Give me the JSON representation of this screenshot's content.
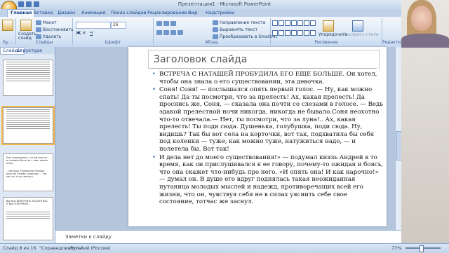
{
  "app": {
    "window_title": "Презентация1 - Microsoft PowerPoint"
  },
  "ribbon": {
    "tabs": [
      "Главная",
      "Вставка",
      "Дизайн",
      "Анимация",
      "Показ слайдов",
      "Рецензирование",
      "Вид",
      "Надстройки"
    ],
    "active_tab": "Главная",
    "groups": {
      "clipboard": "Бу…",
      "slides": "Слайды",
      "font": "Шрифт",
      "paragraph": "Абзац",
      "drawing": "Рисование",
      "editing": "Редакти…"
    },
    "buttons": {
      "create_slide": "Создать слайд",
      "layout": "Макет",
      "restore": "Восстановить",
      "delete": "Удалить",
      "text_direction": "Направление текста",
      "align_text": "Выровнять текст",
      "smartart": "Преобразовать в SmartArt",
      "arrange": "Упорядочить",
      "quick_styles": "Экспресс-стили"
    },
    "font_name": "",
    "font_size": "26"
  },
  "panel": {
    "tabs": [
      "Слайды",
      "Структура"
    ],
    "active_tab": "Слайды"
  },
  "slide": {
    "title": "Заголовок слайда",
    "paragraphs": [
      "ВСТРЕЧА С НАТАШЕЙ ПРОБУДИЛА ЕГО ЕЩЕ БОЛЬШЕ. Он хотел, чтобы она знала о его существовании, эта девочка.",
      "Соня! Соня! — послышался опять первый голос. — Ну, как можно спать! Да ты посмотри, что за прелесть! Ах, какая прелесть! Да проснись же, Соня, — сказала она почти со слезами в голосе. — Ведь эдакой прелестной ночи никогда, никогда не бывало.Соня неохотно что-то отвечала.— Нет, ты посмотри, что за луна!.. Ах, какая прелесть! Ты поди сюда. Душенька, голубушка, поди сюда. Ну, видишь? Так бы вот села на корточки, вот так, подхватила бы себя под коленки — туже, как можно туже, натужиться надо, — и полетела бы. Вот так!",
      "И дела нет до моего существования!» — подумал князь Андрей в то время, как он прислушивался к ее говору, почему-то ожидая и боясь, что она скажет что-нибудь про него. «И опять она! И как нарочно!» — думал он. В душе его вдруг поднялась такая неожиданная путаница молодых мыслей и надежд, противоречащих всей его жизни, что он, чувствуя себя не в силах уяснить себе свое состояние, тотчас же заснул."
    ]
  },
  "notes": {
    "placeholder": "Заметки к слайду"
  },
  "status": {
    "slide_counter": "Слайд 8 из 16",
    "theme": "\"Справедливость\"",
    "language": "Русский (Россия)",
    "zoom": "77%"
  },
  "thumbnails": {
    "items": [
      "Ему подумалось, что ей скучно и неловко быть ни с кем, кроме отца.",
      "…Наташа. Положила Наташа руки на голову, поющую … так как он, в эту минуту.",
      "ВЫ мне ВКЛЮЧИТЬ НА ДЛЯ ВАС И ВЫ ПОЛУЧИЛИ…"
    ]
  }
}
